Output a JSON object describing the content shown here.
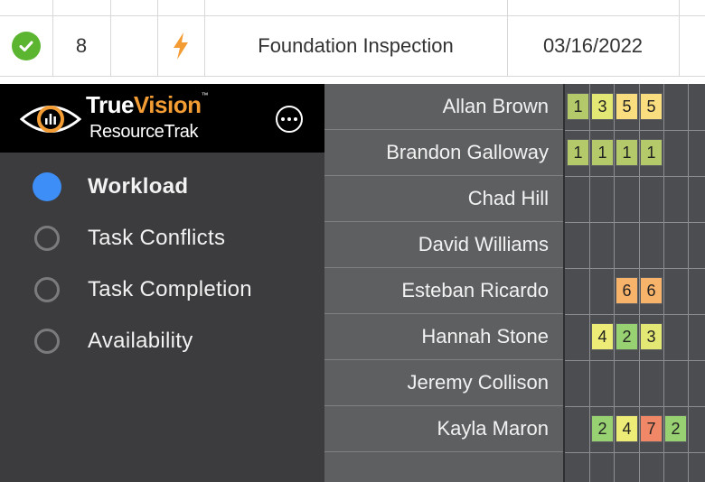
{
  "top_row": {
    "number": "8",
    "task": "Foundation Inspection",
    "date": "03/16/2022"
  },
  "brand": {
    "part1": "True",
    "part2": "Vision",
    "tm": "™",
    "product": "ResourceTrak"
  },
  "nav": [
    {
      "label": "Workload"
    },
    {
      "label": "Task Conflicts"
    },
    {
      "label": "Task Completion"
    },
    {
      "label": "Availability"
    }
  ],
  "people": [
    {
      "name": "Allan Brown"
    },
    {
      "name": "Brandon Galloway"
    },
    {
      "name": "Chad Hill"
    },
    {
      "name": "David Williams"
    },
    {
      "name": "Esteban Ricardo"
    },
    {
      "name": "Hannah Stone"
    },
    {
      "name": "Jeremy Collison"
    },
    {
      "name": "Kayla Maron"
    }
  ],
  "workload": [
    [
      {
        "col": 0,
        "v": "1"
      },
      {
        "col": 1,
        "v": "3"
      },
      {
        "col": 2,
        "v": "5"
      },
      {
        "col": 3,
        "v": "5"
      }
    ],
    [
      {
        "col": 0,
        "v": "1"
      },
      {
        "col": 1,
        "v": "1"
      },
      {
        "col": 2,
        "v": "1"
      },
      {
        "col": 3,
        "v": "1"
      }
    ],
    [],
    [],
    [
      {
        "col": 2,
        "v": "6"
      },
      {
        "col": 3,
        "v": "6"
      }
    ],
    [
      {
        "col": 1,
        "v": "4"
      },
      {
        "col": 2,
        "v": "2"
      },
      {
        "col": 3,
        "v": "3"
      }
    ],
    [],
    [
      {
        "col": 1,
        "v": "2"
      },
      {
        "col": 2,
        "v": "4"
      },
      {
        "col": 3,
        "v": "7"
      },
      {
        "col": 4,
        "v": "2"
      }
    ]
  ],
  "colors": {
    "1": "#b3c96a",
    "2": "#98d171",
    "3": "#e3e774",
    "4": "#ecec76",
    "5": "#f9dd7e",
    "6": "#f8b36a",
    "7": "#f08868",
    "accent": "#f39c34",
    "selected": "#3d8ef7",
    "check": "#5cb531"
  }
}
